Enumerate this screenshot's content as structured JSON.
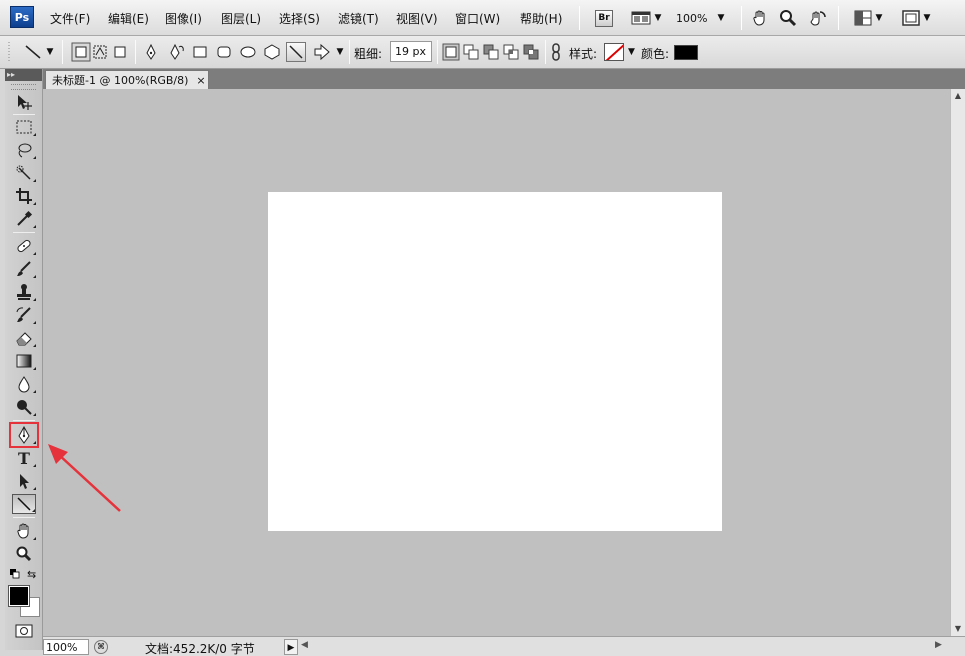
{
  "app": {
    "logo": "Ps"
  },
  "menu": {
    "items": [
      {
        "label": "文件(F)"
      },
      {
        "label": "编辑(E)"
      },
      {
        "label": "图像(I)"
      },
      {
        "label": "图层(L)"
      },
      {
        "label": "选择(S)"
      },
      {
        "label": "滤镜(T)"
      },
      {
        "label": "视图(V)"
      },
      {
        "label": "窗口(W)"
      },
      {
        "label": "帮助(H)"
      }
    ],
    "bridge_label": "Br",
    "zoom_value": "100%"
  },
  "options": {
    "weight_label": "粗细:",
    "weight_value": "19 px",
    "style_label": "样式:",
    "color_label": "颜色:",
    "color_value": "#000000"
  },
  "document": {
    "tab_title": "未标题-1 @ 100%(RGB/8)",
    "tab_close": "×",
    "canvas_color": "#ffffff",
    "workspace_color": "#c0c0c0"
  },
  "status": {
    "zoom": "100%",
    "doc_info": "文档:452.2K/0 字节"
  },
  "toolbox": {
    "foreground_color": "#000000",
    "background_color": "#ffffff",
    "highlighted_tool": "pen-tool"
  },
  "annotation": {
    "color": "#e6323a"
  }
}
